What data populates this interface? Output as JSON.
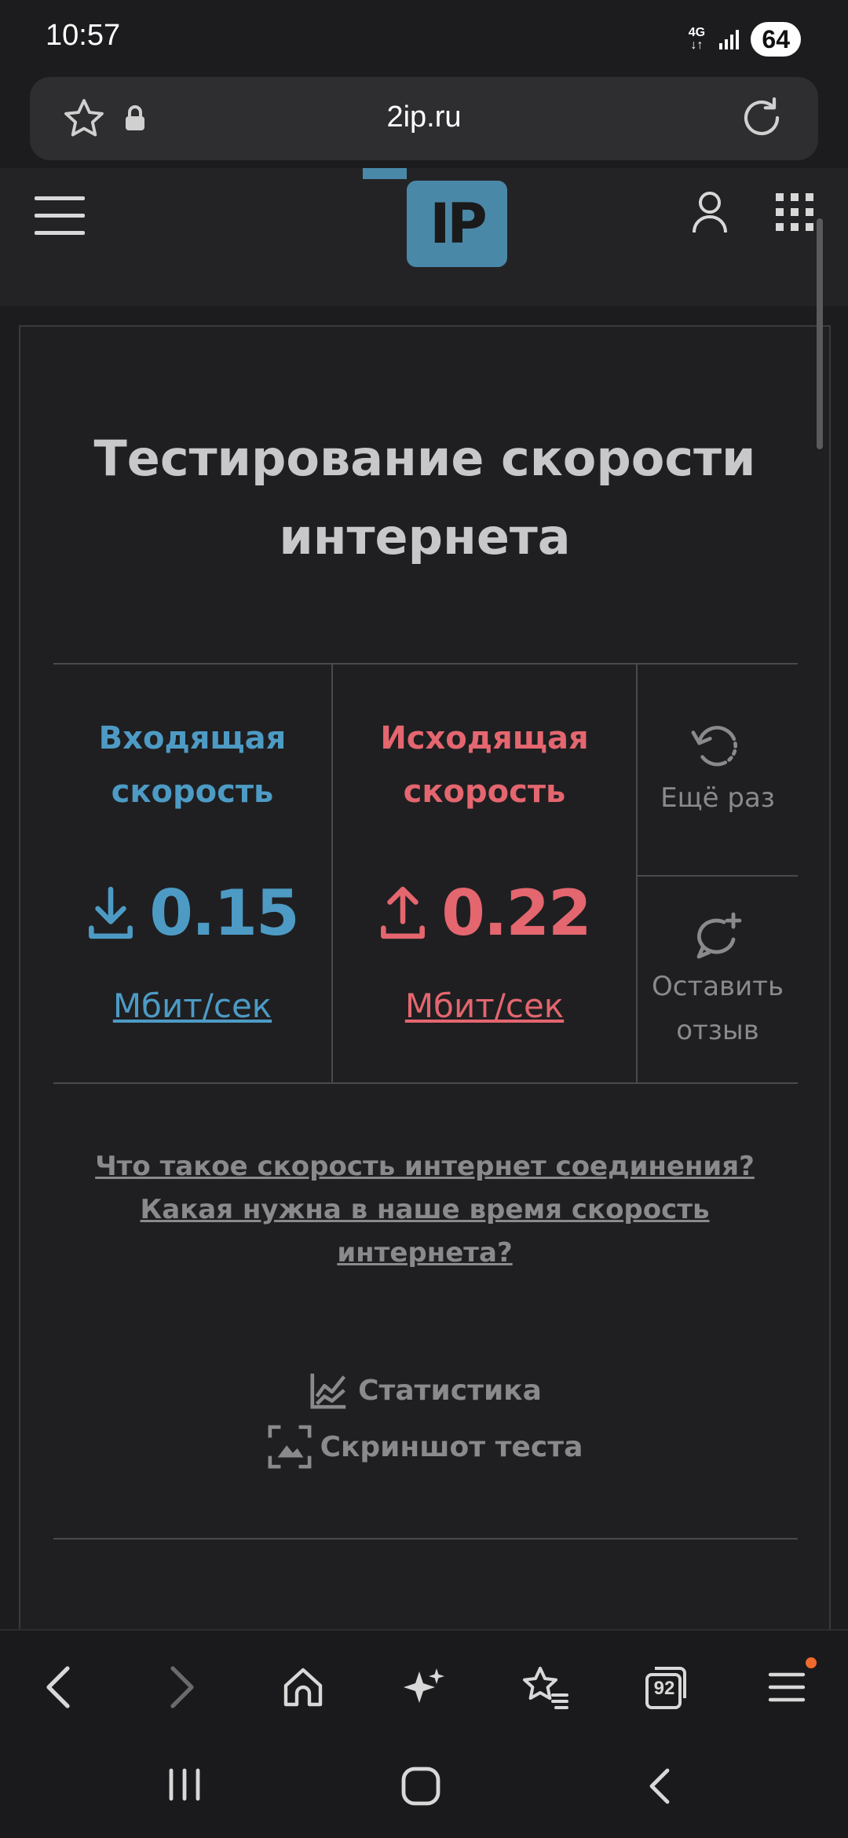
{
  "status_bar": {
    "time": "10:57",
    "network": "4G",
    "battery": "64"
  },
  "browser": {
    "url": "2ip.ru"
  },
  "page": {
    "title": "Тестирование скорости интернета",
    "download": {
      "label": "Входящая скорость",
      "value": "0.15",
      "unit": "Мбит/сек"
    },
    "upload": {
      "label": "Исходящая скорость",
      "value": "0.22",
      "unit": "Мбит/сек"
    },
    "retry_label": "Ещё раз",
    "review_label": "Оставить отзыв",
    "faq": [
      "Что такое скорость интернет соединения?",
      "Какая нужна в наше время скорость интернета?"
    ],
    "stats_label": "Статистика",
    "screenshot_label": "Скриншот теста"
  },
  "toolbar": {
    "tabs_count": "92"
  },
  "colors": {
    "download": "#4d9bc5",
    "upload": "#e4666f",
    "logo": "#4a88a8"
  }
}
